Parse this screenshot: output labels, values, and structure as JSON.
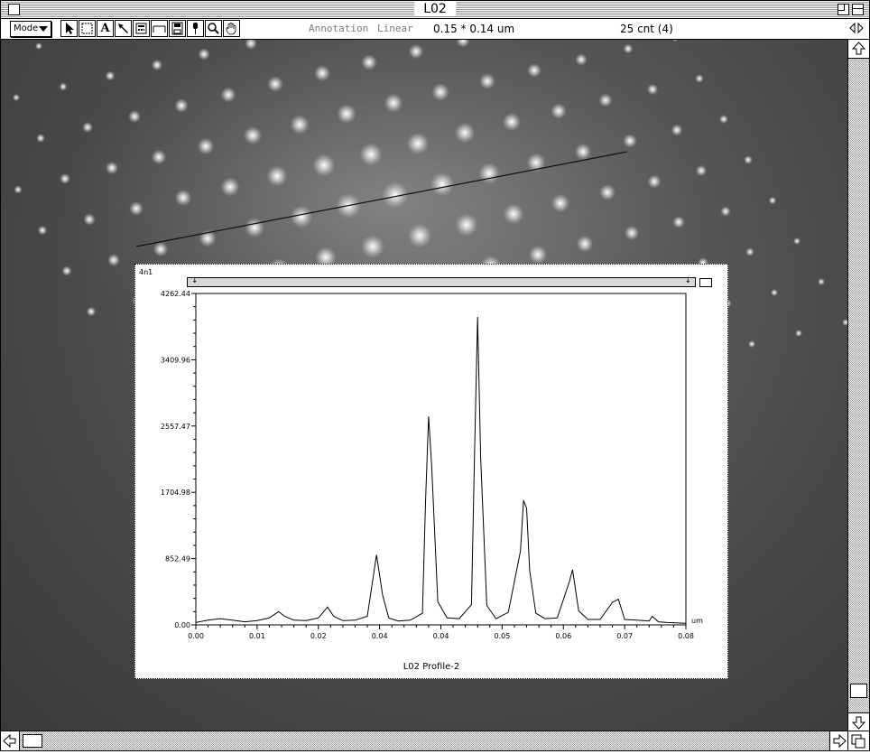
{
  "window": {
    "title": "L02"
  },
  "toolbar": {
    "mode_label": "Mode",
    "tool_text_label": "A",
    "annotation_label": "Annotation",
    "scale_label": "Linear",
    "dimensions": "0.15 * 0.14 um",
    "count": "25 cnt (4)"
  },
  "icons": [
    "arrow-pointer-icon",
    "marquee-icon",
    "text-tool-icon",
    "line-pointer-icon",
    "calculator-icon",
    "line-tool-icon",
    "floppy-disk-icon",
    "pen-icon",
    "magnifier-icon",
    "hand-icon"
  ],
  "profile_window": {
    "corner_tag": "4n1",
    "title": "L02 Profile-2"
  },
  "chart_data": {
    "type": "line",
    "title": "L02 Profile-2",
    "xlabel": "um",
    "ylabel": "",
    "xlim": [
      0,
      0.08
    ],
    "ylim": [
      0,
      4262.44
    ],
    "x_ticks": [
      0.0,
      0.01,
      0.02,
      0.03,
      0.04,
      0.05,
      0.06,
      0.07,
      0.08
    ],
    "x_tick_labels": [
      "0.00",
      "0.01",
      "0.02",
      "0.04",
      "0.04",
      "0.05",
      "0.06",
      "0.07",
      "0.08"
    ],
    "y_ticks": [
      0.0,
      852.49,
      1704.98,
      2557.47,
      3409.96,
      4262.44
    ],
    "y_tick_labels": [
      "0.00",
      "852.49",
      "1704.98",
      "2557.47",
      "3409.96",
      "4262.44"
    ],
    "grid": false,
    "series": [
      {
        "name": "",
        "x": [
          0.0,
          0.002,
          0.004,
          0.006,
          0.008,
          0.01,
          0.012,
          0.0135,
          0.0145,
          0.016,
          0.018,
          0.02,
          0.0215,
          0.0225,
          0.024,
          0.026,
          0.028,
          0.0295,
          0.0305,
          0.0315,
          0.033,
          0.035,
          0.037,
          0.0375,
          0.038,
          0.0385,
          0.0395,
          0.041,
          0.043,
          0.045,
          0.0455,
          0.046,
          0.0465,
          0.0475,
          0.049,
          0.051,
          0.053,
          0.0535,
          0.054,
          0.0545,
          0.0555,
          0.057,
          0.059,
          0.061,
          0.0615,
          0.0625,
          0.064,
          0.066,
          0.068,
          0.069,
          0.07,
          0.072,
          0.074,
          0.0745,
          0.0755,
          0.077,
          0.08
        ],
        "y": [
          30,
          60,
          80,
          60,
          40,
          55,
          90,
          170,
          110,
          60,
          55,
          90,
          230,
          110,
          55,
          60,
          110,
          900,
          380,
          90,
          50,
          60,
          150,
          1580,
          2680,
          2050,
          300,
          90,
          80,
          260,
          2200,
          3960,
          2150,
          250,
          80,
          160,
          950,
          1600,
          1500,
          700,
          150,
          80,
          90,
          560,
          710,
          180,
          70,
          70,
          290,
          330,
          70,
          60,
          50,
          110,
          40,
          30,
          20
        ]
      }
    ]
  }
}
